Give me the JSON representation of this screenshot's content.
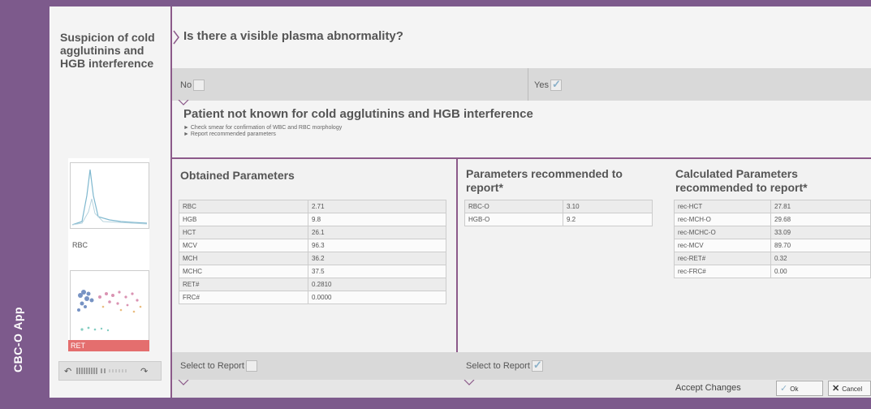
{
  "app": {
    "label": "CBC-O App"
  },
  "sidebar": {
    "title": "Suspicion of cold agglutinins and HGB interference",
    "thumb_labels": [
      "RBC",
      "RET"
    ]
  },
  "question": {
    "text": "Is there a visible plasma abnormality?"
  },
  "answers": {
    "no": "No",
    "yes": "Yes",
    "no_checked": false,
    "yes_checked": true
  },
  "patient": {
    "title": "Patient not known for cold agglutinins and HGB interference",
    "bullets": [
      "► Check smear for confirmation of WBC and RBC morphology",
      "► Report recommended parameters"
    ]
  },
  "obtained": {
    "title": "Obtained Parameters",
    "rows": [
      [
        "RBC",
        "2.71"
      ],
      [
        "HGB",
        "9.8"
      ],
      [
        "HCT",
        "26.1"
      ],
      [
        "MCV",
        "96.3"
      ],
      [
        "MCH",
        "36.2"
      ],
      [
        "MCHC",
        "37.5"
      ],
      [
        "RET#",
        "0.2810"
      ],
      [
        "FRC#",
        "0.0000"
      ]
    ],
    "select_label": "Select to Report",
    "selected": false
  },
  "recommended": {
    "title": "Parameters recommended to report*",
    "rows": [
      [
        "RBC-O",
        "3.10"
      ],
      [
        "HGB-O",
        "9.2"
      ]
    ],
    "select_label": "Select to Report",
    "selected": true
  },
  "calculated": {
    "title": "Calculated Parameters recommended to report*",
    "rows": [
      [
        "rec-HCT",
        "27.81"
      ],
      [
        "rec-MCH-O",
        "29.68"
      ],
      [
        "rec-MCHC-O",
        "33.09"
      ],
      [
        "rec-MCV",
        "89.70"
      ],
      [
        "rec-RET#",
        "0.32"
      ],
      [
        "rec-FRC#",
        "0.00"
      ]
    ]
  },
  "footer": {
    "accept_label": "Accept Changes",
    "ok_label": "Ok",
    "cancel_label": "Cancel"
  },
  "colors": {
    "frame": "#7d5a8c",
    "accent": "#8c5a8a",
    "ret_band": "#e46e6e",
    "check": "#8bb1c9"
  }
}
